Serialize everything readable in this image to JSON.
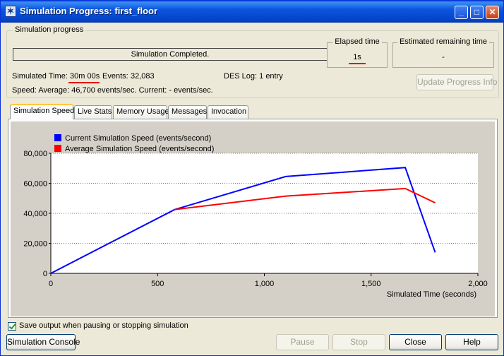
{
  "window": {
    "title": "Simulation Progress: first_floor",
    "minimize": "_",
    "maximize": "□",
    "close": "✕"
  },
  "progress": {
    "group_label": "Simulation progress",
    "bar_text": "Simulation Completed.",
    "elapsed_label": "Elapsed time",
    "elapsed_value": "1s",
    "remaining_label": "Estimated remaining time",
    "remaining_value": "-",
    "simulated_time_label": "Simulated Time:",
    "simulated_time_value": "30m 00s",
    "events_label": "Events:",
    "events_value": "32,083",
    "des_log": "DES Log: 1 entry",
    "speed_text": "Speed: Average:  46,700  events/sec.  Current:  -  events/sec.",
    "update_button": "Update Progress Info"
  },
  "tabs": [
    {
      "label": "Simulation Speed",
      "active": true
    },
    {
      "label": "Live Stats",
      "active": false
    },
    {
      "label": "Memory Usage",
      "active": false
    },
    {
      "label": "Messages",
      "active": false
    },
    {
      "label": "Invocation",
      "active": false
    }
  ],
  "chart_data": {
    "type": "line",
    "xlabel": "Simulated Time (seconds)",
    "ylabel": "",
    "xlim": [
      0,
      2000
    ],
    "ylim": [
      0,
      80000
    ],
    "x_ticks": [
      0,
      500,
      1000,
      1500,
      2000
    ],
    "x_tick_labels": [
      "0",
      "500",
      "1,000",
      "1,500",
      "2,000"
    ],
    "y_ticks": [
      0,
      20000,
      40000,
      60000,
      80000
    ],
    "y_tick_labels": [
      "0",
      "20,000",
      "40,000",
      "60,000",
      "80,000"
    ],
    "grid": "horizontal dotted",
    "legend": "top-left",
    "series": [
      {
        "name": "Current Simulation Speed (events/second)",
        "color": "#0000ff",
        "points": [
          [
            0,
            0
          ],
          [
            580,
            42500
          ],
          [
            1100,
            64500
          ],
          [
            1660,
            70500
          ],
          [
            1800,
            14000
          ]
        ]
      },
      {
        "name": "Average Simulation Speed (events/second)",
        "color": "#ff0000",
        "points": [
          [
            580,
            42500
          ],
          [
            1100,
            51500
          ],
          [
            1660,
            56500
          ],
          [
            1800,
            47000
          ]
        ]
      }
    ]
  },
  "footer": {
    "save_output_label": "Save output when pausing or stopping simulation",
    "save_output_checked": true,
    "console_button": "Simulation Console",
    "pause_button": "Pause",
    "stop_button": "Stop",
    "close_button": "Close",
    "help_button": "Help"
  },
  "colors": {
    "titlebar": "#0a55e0",
    "annotation_underline": "#e00000"
  }
}
